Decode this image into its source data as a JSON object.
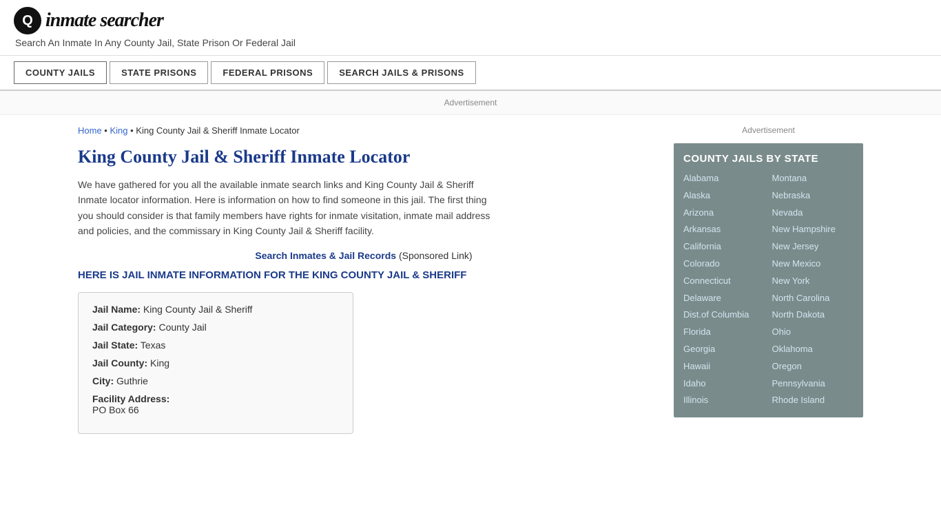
{
  "header": {
    "logo_icon": "🔍",
    "logo_text_part1": "inmate",
    "logo_text_part2": "searcher",
    "tagline": "Search An Inmate In Any County Jail, State Prison Or Federal Jail"
  },
  "nav": {
    "items": [
      {
        "label": "COUNTY JAILS",
        "active": true
      },
      {
        "label": "STATE PRISONS",
        "active": false
      },
      {
        "label": "FEDERAL PRISONS",
        "active": false
      },
      {
        "label": "SEARCH JAILS & PRISONS",
        "active": false
      }
    ]
  },
  "ad_label": "Advertisement",
  "breadcrumb": {
    "home": "Home",
    "separator1": " • ",
    "king": "King",
    "separator2": " • ",
    "current": "King County Jail & Sheriff Inmate Locator"
  },
  "page_title": "King County Jail & Sheriff Inmate Locator",
  "description": "We have gathered for you all the available inmate search links and King County Jail & Sheriff Inmate locator information. Here is information on how to find someone in this jail. The first thing you should consider is that family members have rights for inmate visitation, inmate mail address and policies, and the commissary in King County Jail & Sheriff facility.",
  "sponsored": {
    "link_text": "Search Inmates & Jail Records",
    "suffix": " (Sponsored Link)"
  },
  "sub_heading": "HERE IS JAIL INMATE INFORMATION FOR THE KING COUNTY JAIL & SHERIFF",
  "jail_info": {
    "name_label": "Jail Name:",
    "name_value": "King County Jail & Sheriff",
    "category_label": "Jail Category:",
    "category_value": "County Jail",
    "state_label": "Jail State:",
    "state_value": "Texas",
    "county_label": "Jail County:",
    "county_value": "King",
    "city_label": "City:",
    "city_value": "Guthrie",
    "address_label": "Facility Address:",
    "address_value": "PO Box 66"
  },
  "sidebar": {
    "ad_label": "Advertisement",
    "box_title": "COUNTY JAILS BY STATE",
    "col1": [
      "Alabama",
      "Alaska",
      "Arizona",
      "Arkansas",
      "California",
      "Colorado",
      "Connecticut",
      "Delaware",
      "Dist.of Columbia",
      "Florida",
      "Georgia",
      "Hawaii",
      "Idaho",
      "Illinois"
    ],
    "col2": [
      "Montana",
      "Nebraska",
      "Nevada",
      "New Hampshire",
      "New Jersey",
      "New Mexico",
      "New York",
      "North Carolina",
      "North Dakota",
      "Ohio",
      "Oklahoma",
      "Oregon",
      "Pennsylvania",
      "Rhode Island"
    ]
  }
}
